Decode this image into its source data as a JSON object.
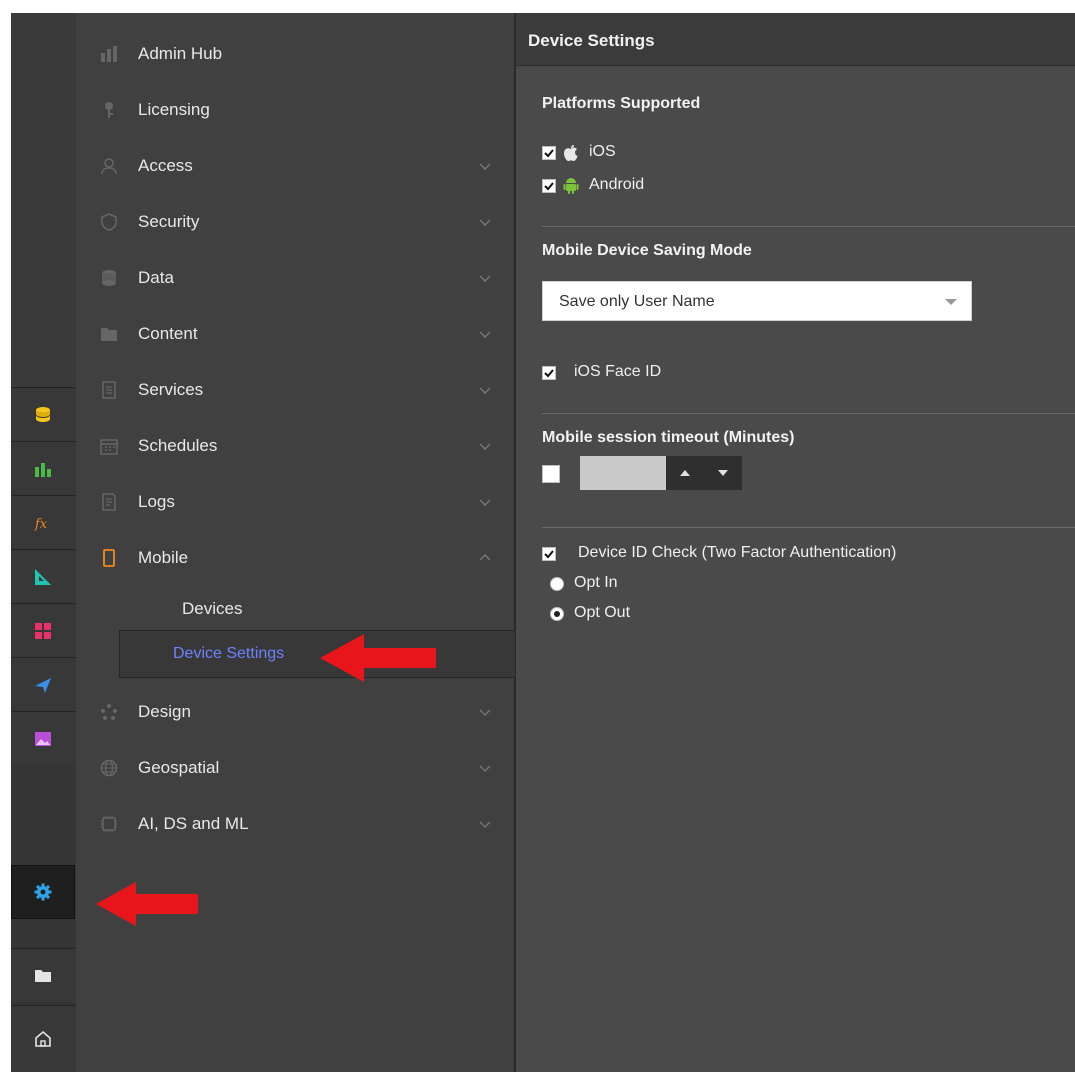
{
  "nav": {
    "items": [
      {
        "label": "Admin Hub",
        "icon": "bar-chart-icon",
        "chevron": ""
      },
      {
        "label": "Licensing",
        "icon": "key-icon",
        "chevron": ""
      },
      {
        "label": "Access",
        "icon": "user-icon",
        "chevron": "down"
      },
      {
        "label": "Security",
        "icon": "shield-icon",
        "chevron": "down"
      },
      {
        "label": "Data",
        "icon": "database-icon",
        "chevron": "down"
      },
      {
        "label": "Content",
        "icon": "folder-icon",
        "chevron": "down"
      },
      {
        "label": "Services",
        "icon": "document-icon",
        "chevron": "down"
      },
      {
        "label": "Schedules",
        "icon": "calendar-icon",
        "chevron": "down"
      },
      {
        "label": "Logs",
        "icon": "log-icon",
        "chevron": "down"
      },
      {
        "label": "Mobile",
        "icon": "mobile-icon",
        "chevron": "up"
      },
      {
        "label": "Design",
        "icon": "palette-icon",
        "chevron": "down"
      },
      {
        "label": "Geospatial",
        "icon": "globe-icon",
        "chevron": "down"
      },
      {
        "label": "AI, DS and ML",
        "icon": "chip-icon",
        "chevron": "down"
      }
    ],
    "mobile_sub": {
      "devices": "Devices",
      "device_settings": "Device Settings"
    }
  },
  "rail": {
    "buttons": [
      "database-icon",
      "bar-chart-icon",
      "formula-icon",
      "ruler-icon",
      "grid-icon",
      "send-icon",
      "image-icon",
      "gear-icon",
      "folder-icon",
      "home-icon"
    ],
    "active": "gear-icon"
  },
  "content": {
    "header_title": "Device Settings",
    "platforms": {
      "title": "Platforms Supported",
      "ios_label": "iOS",
      "ios_checked": true,
      "android_label": "Android",
      "android_checked": true
    },
    "saving_mode": {
      "title": "Mobile Device Saving Mode",
      "selected": "Save only User Name"
    },
    "face_id": {
      "label": "iOS Face ID",
      "checked": true
    },
    "session_timeout": {
      "title": "Mobile session timeout (Minutes)",
      "checked": false,
      "value": ""
    },
    "device_id_check": {
      "label": "Device ID Check (Two Factor Authentication)",
      "checked": true,
      "options": [
        "Opt In",
        "Opt Out"
      ],
      "selected": "Opt Out"
    }
  },
  "colors": {
    "accent_selected": "#6d82ff",
    "annotation_arrow": "#e8161b",
    "android_green": "#7cc23b",
    "database_yellow": "#f5c518",
    "gear_blue": "#2fa3e8"
  }
}
